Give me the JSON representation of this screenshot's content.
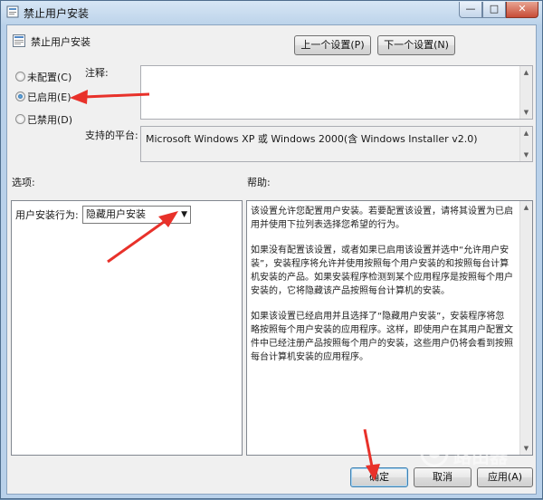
{
  "window": {
    "title": "禁止用户安装",
    "minimize_glyph": "—",
    "maximize_glyph": "□",
    "close_glyph": "✕"
  },
  "header": {
    "policy_name": "禁止用户安装",
    "prev_button": "上一个设置(P)",
    "next_button": "下一个设置(N)"
  },
  "state": {
    "options": [
      {
        "label": "未配置(C)",
        "selected": false
      },
      {
        "label": "已启用(E)",
        "selected": true
      },
      {
        "label": "已禁用(D)",
        "selected": false
      }
    ]
  },
  "comment": {
    "label": "注释:",
    "value": ""
  },
  "platform": {
    "label": "支持的平台:",
    "value": "Microsoft Windows XP 或 Windows 2000(含 Windows Installer v2.0)"
  },
  "options_section": {
    "label": "选项:",
    "behavior_label": "用户安装行为:",
    "behavior_value": "隐藏用户安装"
  },
  "help_section": {
    "label": "帮助:",
    "paragraphs": [
      "该设置允许您配置用户安装。若要配置该设置，请将其设置为已启用并使用下拉列表选择您希望的行为。",
      "如果没有配置该设置，或者如果已启用该设置并选中“允许用户安装”，安装程序将允许并使用按照每个用户安装的和按照每台计算机安装的产品。如果安装程序检测到某个应用程序是按照每个用户安装的，它将隐藏该产品按照每台计算机的安装。",
      "如果该设置已经启用并且选择了“隐藏用户安装”，安装程序将忽略按照每个用户安装的应用程序。这样，即使用户在其用户配置文件中已经注册产品按照每个用户的安装，这些用户仍将会看到按照每台计算机安装的应用程序。"
    ]
  },
  "footer": {
    "ok": "确定",
    "cancel": "取消",
    "apply": "应用(A)"
  },
  "watermark": {
    "text": "路由器"
  },
  "colors": {
    "annotation_arrow": "#e8312a",
    "title_bar": "#bcd3ea"
  }
}
